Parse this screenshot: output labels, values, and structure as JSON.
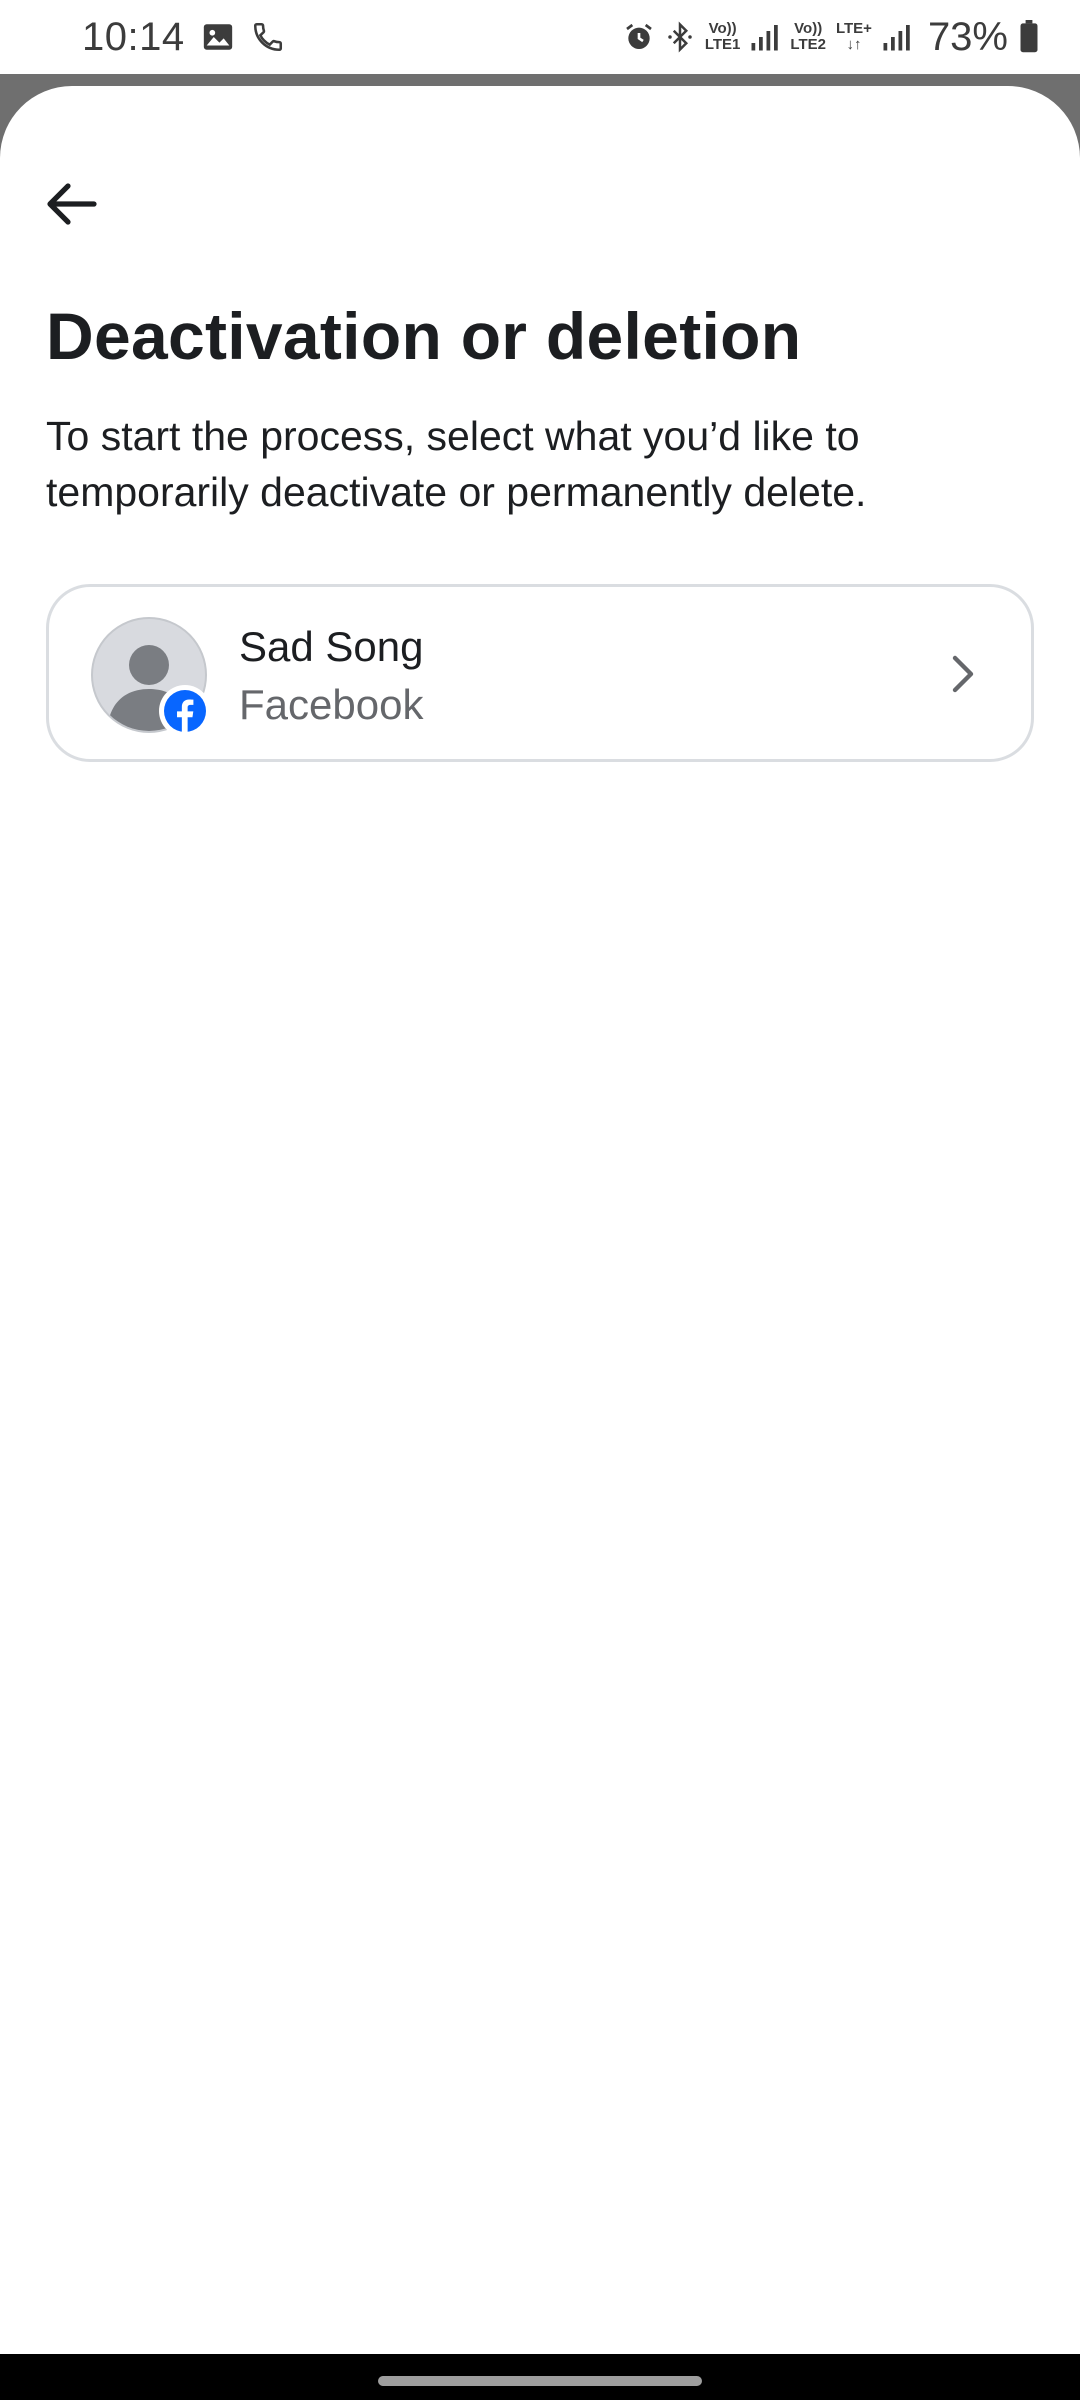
{
  "status_bar": {
    "time": "10:14",
    "left_icons": [
      "gallery-icon",
      "phone-call-icon"
    ],
    "right_icons": [
      "alarm-icon",
      "bluetooth-icon",
      "volte-lte1-icon",
      "signal-icon",
      "volte-lte2-icon",
      "lte-plus-data-icon",
      "signal-icon",
      "battery-icon"
    ],
    "lte1_top": "Vo))",
    "lte1_bottom": "LTE1",
    "lte2_top": "Vo))",
    "lte2_bottom": "LTE2",
    "lte_plus": "LTE+",
    "battery_percent": "73%"
  },
  "header": {
    "back_icon": "arrow-left-icon"
  },
  "main": {
    "title": "Deactivation or deletion",
    "description": "To start the process, select what you’d like to temporarily deactivate or permanently delete."
  },
  "account": {
    "name": "Sad Song",
    "platform": "Facebook",
    "avatar_icon": "default-avatar-icon",
    "badge_icon": "facebook-logo-icon",
    "chevron_icon": "chevron-right-icon"
  },
  "colors": {
    "facebook_blue": "#0866ff",
    "title_text": "#1c1e21",
    "secondary_text": "#65676b",
    "card_border": "#dadde1"
  }
}
